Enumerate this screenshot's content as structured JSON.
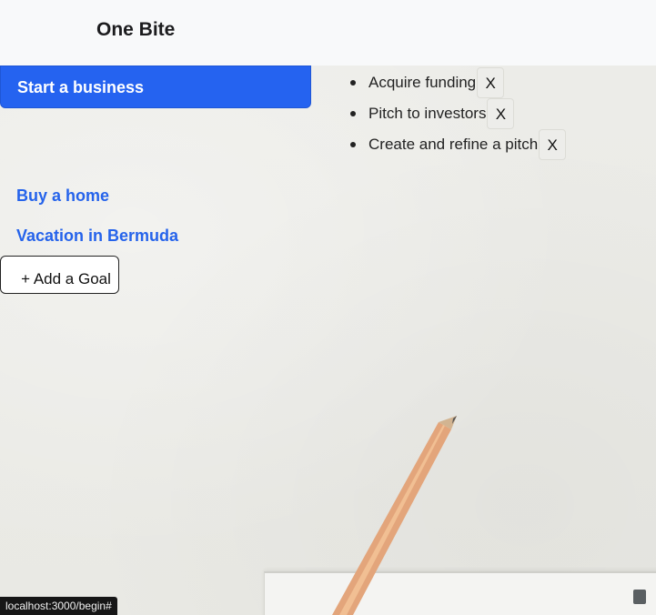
{
  "header": {
    "brand": "One Bite"
  },
  "goals": {
    "active": "Start a business",
    "others": [
      "Buy a home",
      "Vacation in Bermuda"
    ],
    "add_label": "+ Add a Goal"
  },
  "tasks": [
    {
      "label": "Acquire funding",
      "remove": "X"
    },
    {
      "label": "Pitch to investors",
      "remove": "X"
    },
    {
      "label": "Create and refine a pitch",
      "remove": "X"
    }
  ],
  "status_bar": {
    "url": "localhost:3000/begin#"
  },
  "colors": {
    "accent": "#2563f0",
    "link": "#2563eb",
    "header_bg": "#f8f9fa",
    "page_bg": "#ebebe6"
  }
}
